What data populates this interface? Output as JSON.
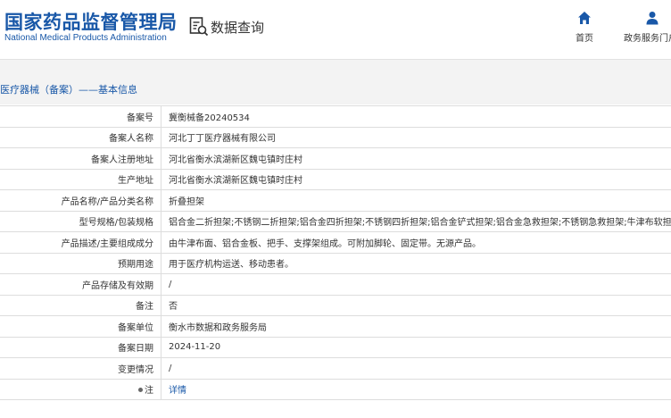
{
  "header": {
    "logo_cn": "国家药品监督管理局",
    "logo_en": "National Medical Products Administration",
    "query_title": "数据查询",
    "nav": {
      "home": "首页",
      "services": "政务服务门户"
    }
  },
  "breadcrumb": "医疗器械（备案）——基本信息",
  "table": {
    "rows": [
      {
        "label": "备案号",
        "value": "冀衡械备20240534"
      },
      {
        "label": "备案人名称",
        "value": "河北丁丁医疗器械有限公司"
      },
      {
        "label": "备案人注册地址",
        "value": "河北省衡水滨湖新区魏屯镇时庄村"
      },
      {
        "label": "生产地址",
        "value": "河北省衡水滨湖新区魏屯镇时庄村"
      },
      {
        "label": "产品名称/产品分类名称",
        "value": "折叠担架"
      },
      {
        "label": "型号规格/包装规格",
        "value": "铝合金二折担架;不锈钢二折担架;铝合金四折担架;不锈钢四折担架;铝合金铲式担架;铝合金急救担架;不锈钢急救担架;牛津布软担架"
      },
      {
        "label": "产品描述/主要组成成分",
        "value": "由牛津布面、铝合金板、把手、支撑架组成。可附加脚轮、固定带。无源产品。"
      },
      {
        "label": "预期用途",
        "value": "用于医疗机构运送、移动患者。"
      },
      {
        "label": "产品存储及有效期",
        "value": "/"
      },
      {
        "label": "备注",
        "value": "否"
      },
      {
        "label": "备案单位",
        "value": "衡水市数据和政务服务局"
      },
      {
        "label": "备案日期",
        "value": "2024-11-20"
      },
      {
        "label": "变更情况",
        "value": "/"
      },
      {
        "label": "注",
        "value": "详情"
      }
    ]
  },
  "colors": {
    "brand_blue": "#1958a8",
    "band_gray": "#f3f3f3",
    "border": "#dddddd"
  },
  "icons": {
    "query": "search-document-icon",
    "home": "home-icon",
    "services": "user-icon",
    "note": "lightbulb-icon"
  }
}
